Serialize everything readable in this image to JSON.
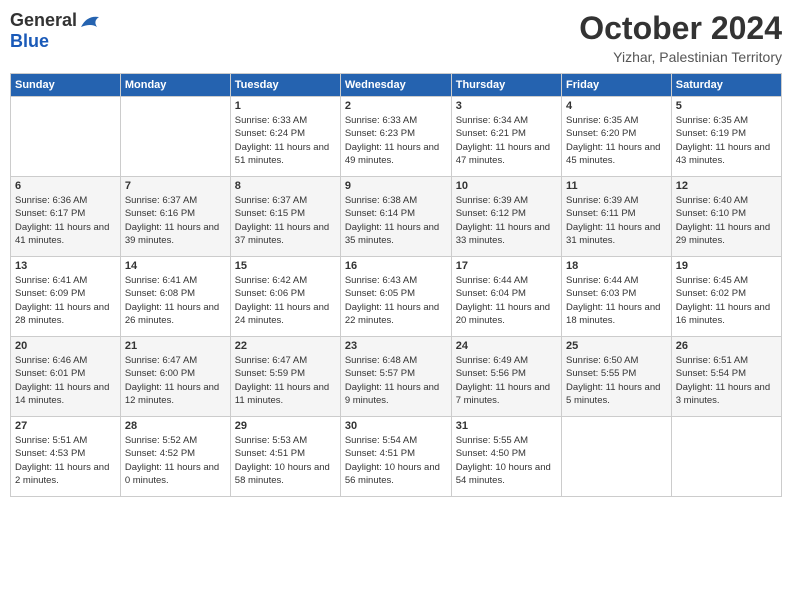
{
  "logo": {
    "general": "General",
    "blue": "Blue",
    "wing_symbol": "▶"
  },
  "title": {
    "month": "October 2024",
    "location": "Yizhar, Palestinian Territory"
  },
  "header_days": [
    "Sunday",
    "Monday",
    "Tuesday",
    "Wednesday",
    "Thursday",
    "Friday",
    "Saturday"
  ],
  "weeks": [
    [
      {
        "day": "",
        "info": ""
      },
      {
        "day": "",
        "info": ""
      },
      {
        "day": "1",
        "info": "Sunrise: 6:33 AM\nSunset: 6:24 PM\nDaylight: 11 hours and 51 minutes."
      },
      {
        "day": "2",
        "info": "Sunrise: 6:33 AM\nSunset: 6:23 PM\nDaylight: 11 hours and 49 minutes."
      },
      {
        "day": "3",
        "info": "Sunrise: 6:34 AM\nSunset: 6:21 PM\nDaylight: 11 hours and 47 minutes."
      },
      {
        "day": "4",
        "info": "Sunrise: 6:35 AM\nSunset: 6:20 PM\nDaylight: 11 hours and 45 minutes."
      },
      {
        "day": "5",
        "info": "Sunrise: 6:35 AM\nSunset: 6:19 PM\nDaylight: 11 hours and 43 minutes."
      }
    ],
    [
      {
        "day": "6",
        "info": "Sunrise: 6:36 AM\nSunset: 6:17 PM\nDaylight: 11 hours and 41 minutes."
      },
      {
        "day": "7",
        "info": "Sunrise: 6:37 AM\nSunset: 6:16 PM\nDaylight: 11 hours and 39 minutes."
      },
      {
        "day": "8",
        "info": "Sunrise: 6:37 AM\nSunset: 6:15 PM\nDaylight: 11 hours and 37 minutes."
      },
      {
        "day": "9",
        "info": "Sunrise: 6:38 AM\nSunset: 6:14 PM\nDaylight: 11 hours and 35 minutes."
      },
      {
        "day": "10",
        "info": "Sunrise: 6:39 AM\nSunset: 6:12 PM\nDaylight: 11 hours and 33 minutes."
      },
      {
        "day": "11",
        "info": "Sunrise: 6:39 AM\nSunset: 6:11 PM\nDaylight: 11 hours and 31 minutes."
      },
      {
        "day": "12",
        "info": "Sunrise: 6:40 AM\nSunset: 6:10 PM\nDaylight: 11 hours and 29 minutes."
      }
    ],
    [
      {
        "day": "13",
        "info": "Sunrise: 6:41 AM\nSunset: 6:09 PM\nDaylight: 11 hours and 28 minutes."
      },
      {
        "day": "14",
        "info": "Sunrise: 6:41 AM\nSunset: 6:08 PM\nDaylight: 11 hours and 26 minutes."
      },
      {
        "day": "15",
        "info": "Sunrise: 6:42 AM\nSunset: 6:06 PM\nDaylight: 11 hours and 24 minutes."
      },
      {
        "day": "16",
        "info": "Sunrise: 6:43 AM\nSunset: 6:05 PM\nDaylight: 11 hours and 22 minutes."
      },
      {
        "day": "17",
        "info": "Sunrise: 6:44 AM\nSunset: 6:04 PM\nDaylight: 11 hours and 20 minutes."
      },
      {
        "day": "18",
        "info": "Sunrise: 6:44 AM\nSunset: 6:03 PM\nDaylight: 11 hours and 18 minutes."
      },
      {
        "day": "19",
        "info": "Sunrise: 6:45 AM\nSunset: 6:02 PM\nDaylight: 11 hours and 16 minutes."
      }
    ],
    [
      {
        "day": "20",
        "info": "Sunrise: 6:46 AM\nSunset: 6:01 PM\nDaylight: 11 hours and 14 minutes."
      },
      {
        "day": "21",
        "info": "Sunrise: 6:47 AM\nSunset: 6:00 PM\nDaylight: 11 hours and 12 minutes."
      },
      {
        "day": "22",
        "info": "Sunrise: 6:47 AM\nSunset: 5:59 PM\nDaylight: 11 hours and 11 minutes."
      },
      {
        "day": "23",
        "info": "Sunrise: 6:48 AM\nSunset: 5:57 PM\nDaylight: 11 hours and 9 minutes."
      },
      {
        "day": "24",
        "info": "Sunrise: 6:49 AM\nSunset: 5:56 PM\nDaylight: 11 hours and 7 minutes."
      },
      {
        "day": "25",
        "info": "Sunrise: 6:50 AM\nSunset: 5:55 PM\nDaylight: 11 hours and 5 minutes."
      },
      {
        "day": "26",
        "info": "Sunrise: 6:51 AM\nSunset: 5:54 PM\nDaylight: 11 hours and 3 minutes."
      }
    ],
    [
      {
        "day": "27",
        "info": "Sunrise: 5:51 AM\nSunset: 4:53 PM\nDaylight: 11 hours and 2 minutes."
      },
      {
        "day": "28",
        "info": "Sunrise: 5:52 AM\nSunset: 4:52 PM\nDaylight: 11 hours and 0 minutes."
      },
      {
        "day": "29",
        "info": "Sunrise: 5:53 AM\nSunset: 4:51 PM\nDaylight: 10 hours and 58 minutes."
      },
      {
        "day": "30",
        "info": "Sunrise: 5:54 AM\nSunset: 4:51 PM\nDaylight: 10 hours and 56 minutes."
      },
      {
        "day": "31",
        "info": "Sunrise: 5:55 AM\nSunset: 4:50 PM\nDaylight: 10 hours and 54 minutes."
      },
      {
        "day": "",
        "info": ""
      },
      {
        "day": "",
        "info": ""
      }
    ]
  ]
}
